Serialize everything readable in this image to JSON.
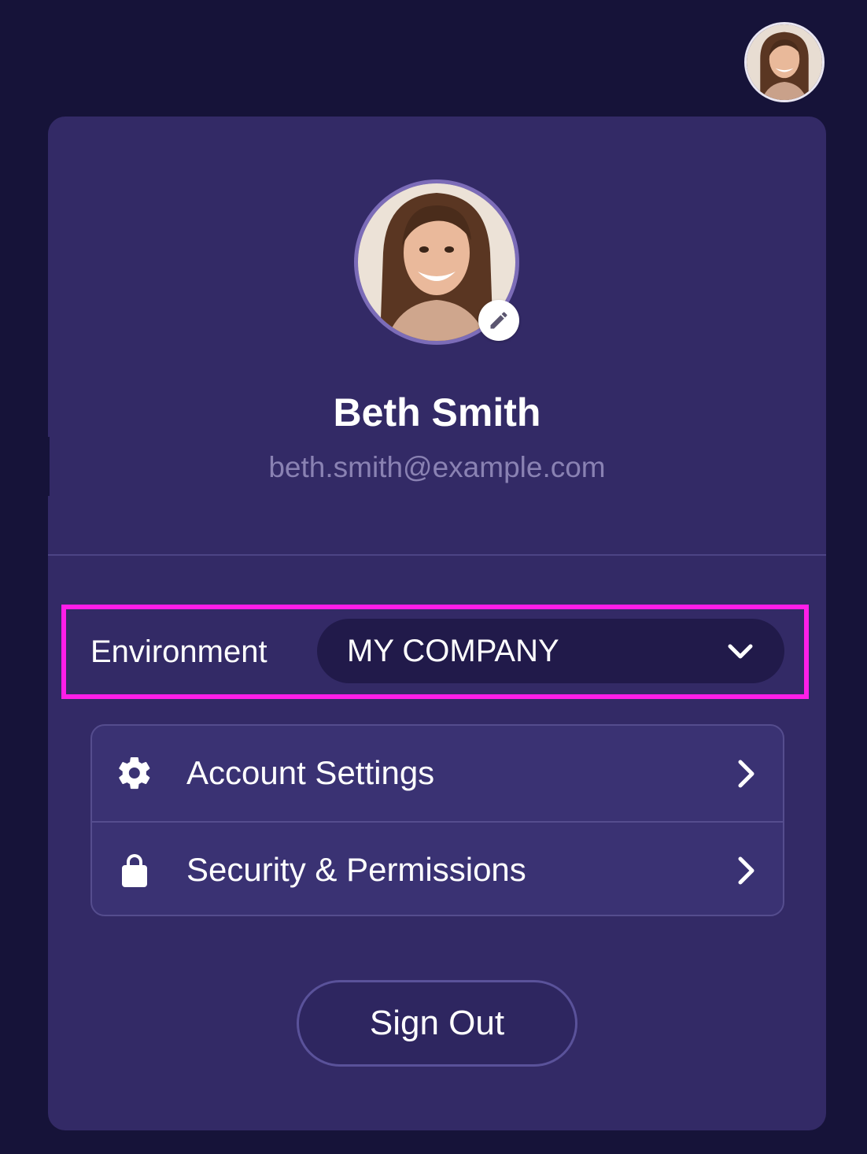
{
  "profile": {
    "name": "Beth Smith",
    "email": "beth.smith@example.com",
    "avatar_icon": "user-photo",
    "edit_icon": "pencil-icon"
  },
  "environment": {
    "label": "Environment",
    "selected": "MY COMPANY",
    "chevron_icon": "chevron-down-icon",
    "highlight_color": "#ff1ee8"
  },
  "menu": {
    "items": [
      {
        "label": "Account Settings",
        "icon": "gear-icon"
      },
      {
        "label": "Security & Permissions",
        "icon": "lock-icon"
      }
    ]
  },
  "actions": {
    "sign_out_label": "Sign Out"
  },
  "colors": {
    "background": "#161339",
    "panel": "#332a66",
    "select_bg": "#211a4a",
    "email_text": "#8a82b3"
  }
}
